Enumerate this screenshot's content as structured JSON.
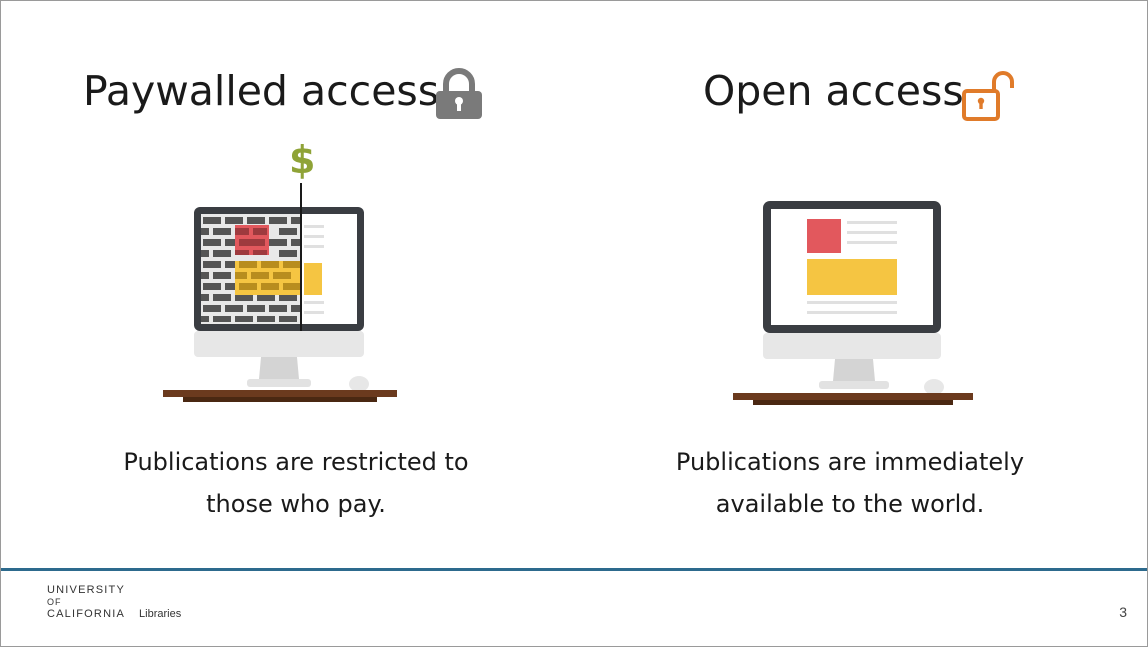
{
  "slide": {
    "page_number": "3"
  },
  "left_panel": {
    "heading": "Paywalled access",
    "lock_icon": "closed-padlock-icon",
    "price_symbol": "$",
    "caption_line1": "Publications are restricted to",
    "caption_line2": "those who pay."
  },
  "right_panel": {
    "heading": "Open access",
    "lock_icon": "open-padlock-icon",
    "caption_line1": "Publications are immediately",
    "caption_line2": "available to the world."
  },
  "footer": {
    "logo_line1": "UNIVERSITY",
    "logo_line2": "OF",
    "logo_line3": "CALIFORNIA",
    "logo_suffix": "Libraries",
    "rule_color": "#2d6a8d"
  },
  "colors": {
    "closed_lock": "#7a7a7a",
    "open_lock": "#e07b2a",
    "dollar": "#8fa337",
    "red_block": "#e2585d",
    "yellow_block": "#f5c542",
    "monitor_bezel": "#3a3d42",
    "desk": "#6b3a1e"
  }
}
